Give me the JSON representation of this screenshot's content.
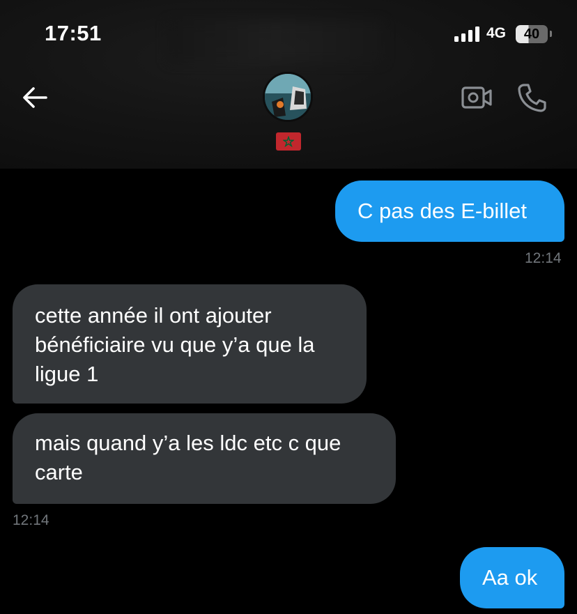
{
  "status_bar": {
    "time": "17:51",
    "network": "4G",
    "battery": "40"
  },
  "header": {
    "back_icon": "arrow-left-icon",
    "flag_icon": "morocco-flag-icon",
    "video_icon": "video-camera-icon",
    "call_icon": "phone-icon"
  },
  "colors": {
    "outgoing": "#1d9bf0",
    "incoming": "#333639",
    "timestamp": "#71767b",
    "flag_red": "#c1272d",
    "flag_green": "#006233"
  },
  "messages": [
    {
      "direction": "out",
      "text": "C pas des E-billet"
    },
    {
      "direction": "meta",
      "time": "12:14"
    },
    {
      "direction": "in",
      "text": "cette année il ont ajouter bénéficiaire vu que y’a que la ligue 1"
    },
    {
      "direction": "in",
      "text": "mais quand y’a les ldc etc c que carte"
    },
    {
      "direction": "meta",
      "time": "12:14"
    },
    {
      "direction": "out",
      "text": "Aa ok"
    }
  ]
}
